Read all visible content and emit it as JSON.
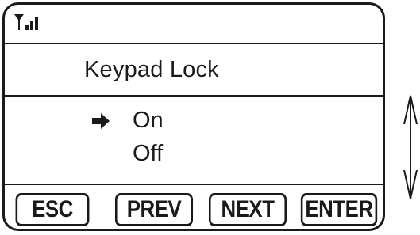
{
  "status_bar": {
    "signal_icon": "signal-strength-icon"
  },
  "menu": {
    "title": "Keypad Lock",
    "options": [
      {
        "label": "On",
        "selected": true
      },
      {
        "label": "Off",
        "selected": false
      }
    ],
    "selection_icon": "right-arrow-icon"
  },
  "softkeys": {
    "esc": "ESC",
    "prev": "PREV",
    "next": "NEXT",
    "enter": "ENTER"
  },
  "scroll_indicator_icon": "up-down-arrow-icon",
  "colors": {
    "foreground": "#1a1a1a",
    "background": "#ffffff"
  }
}
